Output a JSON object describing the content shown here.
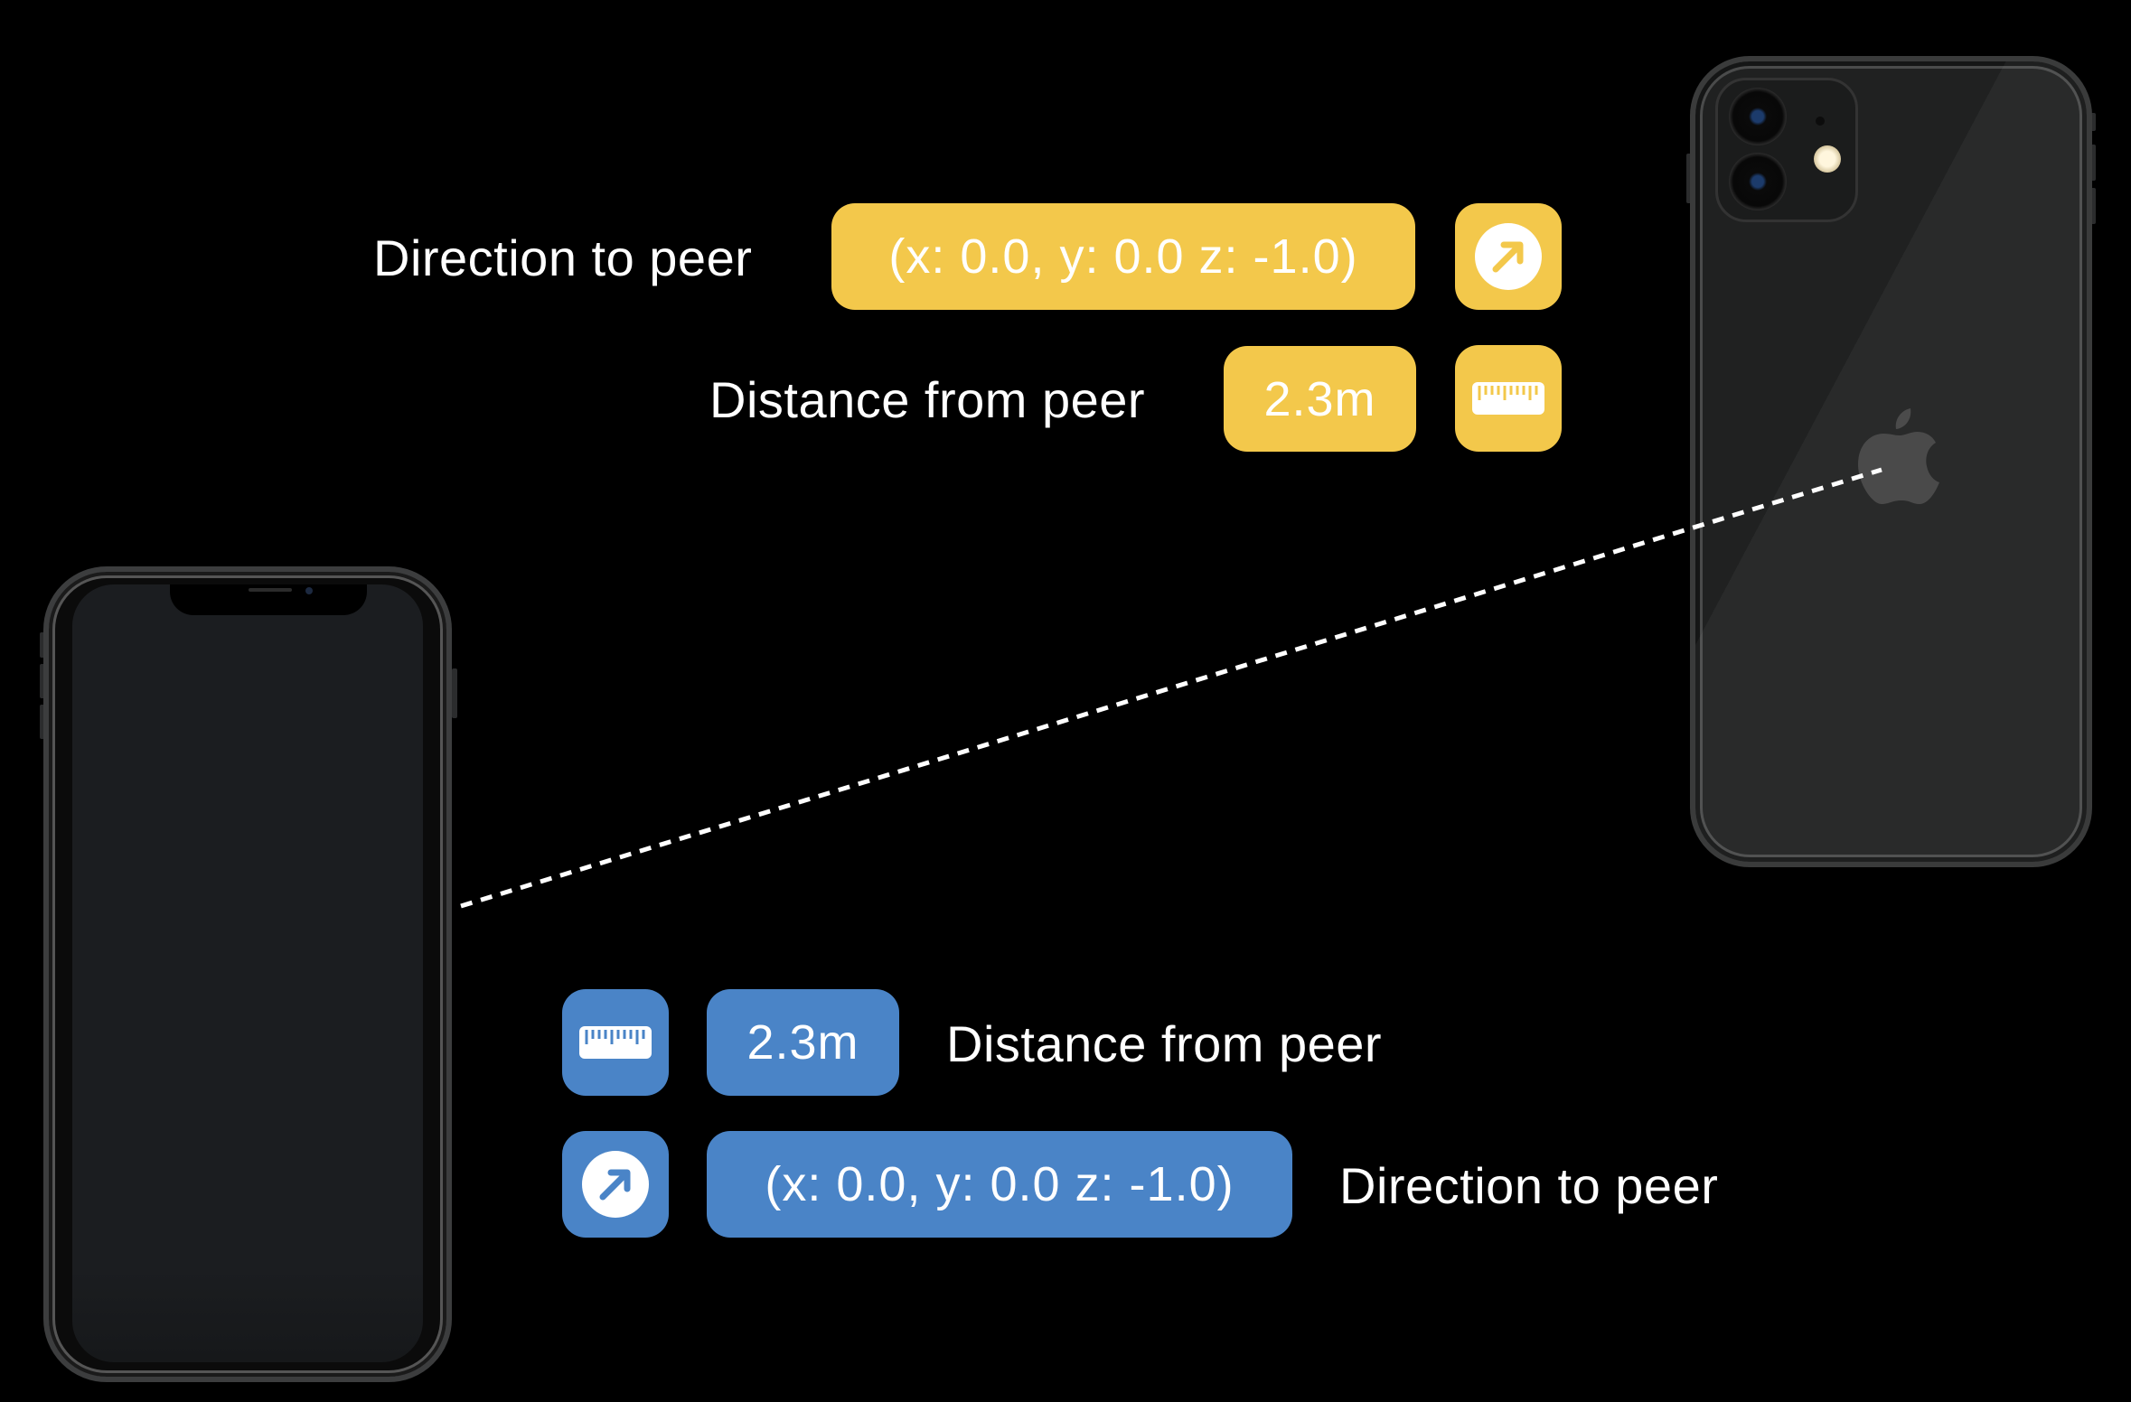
{
  "scene": {
    "description": "Two iPhones exchanging peer direction and distance",
    "colors": {
      "background": "#000000",
      "peer_a_accent": "#F3C84B",
      "peer_b_accent": "#4A84C7",
      "text": "#FFFFFF"
    }
  },
  "peer_top": {
    "direction": {
      "label": "Direction to peer",
      "value": "(x: 0.0, y: 0.0 z: -1.0)",
      "icon": "arrow-up-right-circle-icon"
    },
    "distance": {
      "label": "Distance from peer",
      "value": "2.3m",
      "icon": "ruler-icon"
    }
  },
  "peer_bottom": {
    "distance": {
      "label": "Distance from peer",
      "value": "2.3m",
      "icon": "ruler-icon"
    },
    "direction": {
      "label": "Direction to peer",
      "value": "(x: 0.0, y: 0.0 z: -1.0)",
      "icon": "arrow-up-right-circle-icon"
    }
  },
  "devices": {
    "front_phone": "iPhone front view",
    "back_phone": "iPhone rear view"
  },
  "connector": {
    "style": "dashed",
    "from": "front_phone",
    "to": "back_phone"
  }
}
